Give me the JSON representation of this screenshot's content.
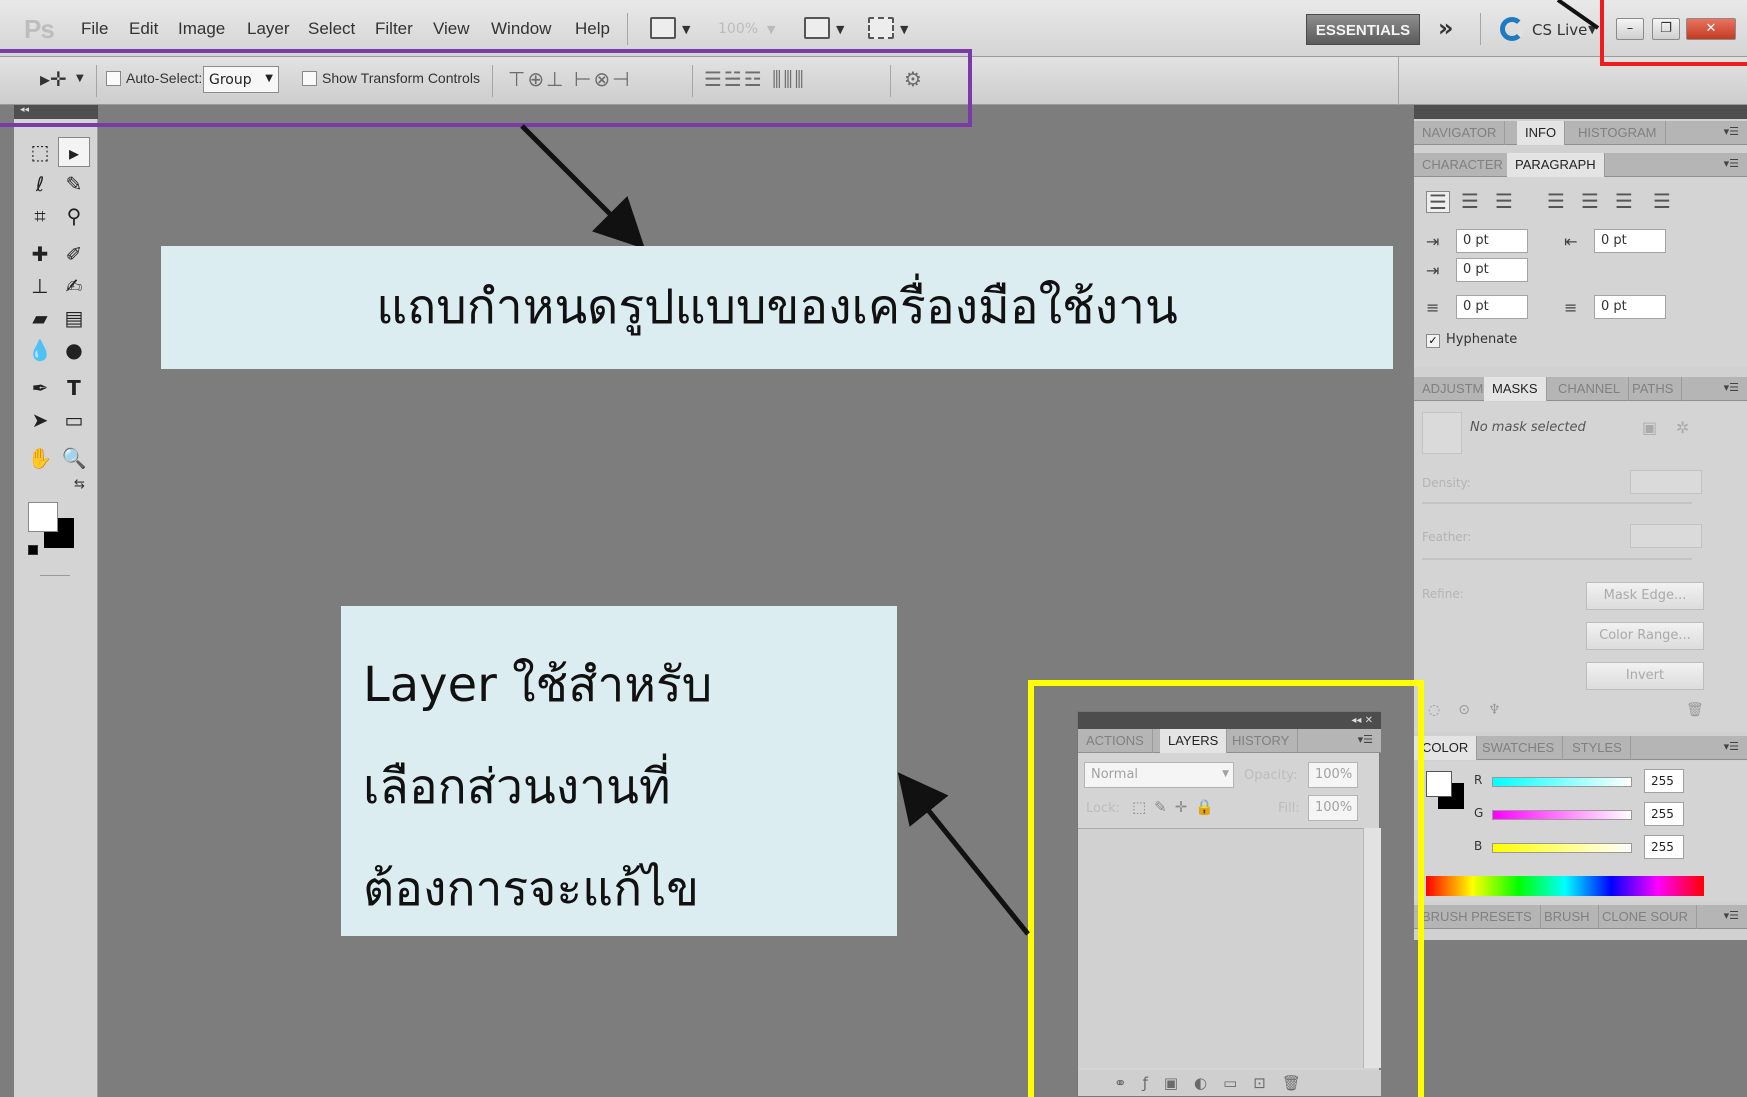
{
  "menubar": {
    "logo": "Ps",
    "items": [
      "File",
      "Edit",
      "Image",
      "Layer",
      "Select",
      "Filter",
      "View",
      "Window",
      "Help"
    ],
    "zoom": "100%",
    "essentials": "ESSENTIALS",
    "cslive": "CS Live"
  },
  "optionsbar": {
    "auto_select_label": "Auto-Select:",
    "auto_select_value": "Group",
    "show_transform_label": "Show Transform Controls"
  },
  "panels": {
    "group1_tabs": [
      "NAVIGATOR",
      "INFO",
      "HISTOGRAM"
    ],
    "group2_tabs": [
      "CHARACTER",
      "PARAGRAPH"
    ],
    "para_values": [
      "0 pt",
      "0 pt",
      "0 pt",
      "0 pt",
      "0 pt"
    ],
    "hyphenate": "Hyphenate",
    "group3_tabs": [
      "ADJUSTM",
      "MASKS",
      "CHANNEL",
      "PATHS"
    ],
    "no_mask": "No mask selected",
    "density": "Density:",
    "feather": "Feather:",
    "refine": "Refine:",
    "mask_edge": "Mask Edge...",
    "color_range": "Color Range...",
    "invert": "Invert",
    "group4_tabs": [
      "COLOR",
      "SWATCHES",
      "STYLES"
    ],
    "rgb_labels": [
      "R",
      "G",
      "B"
    ],
    "rgb_values": [
      "255",
      "255",
      "255"
    ],
    "group5_tabs": [
      "BRUSH PRESETS",
      "BRUSH",
      "CLONE SOUR"
    ]
  },
  "layers_panel": {
    "tabs": [
      "ACTIONS",
      "LAYERS",
      "HISTORY"
    ],
    "blend_mode": "Normal",
    "opacity_label": "Opacity:",
    "opacity_value": "100%",
    "lock_label": "Lock:",
    "fill_label": "Fill:",
    "fill_value": "100%"
  },
  "annotations": {
    "options_note": "แถบกำหนดรูปแบบของเครื่องมือใช้งาน",
    "layer_note": "Layer ใช้สำหรับ\nเลือกส่วนงานที่\nต้องการจะแก้ไข"
  },
  "colors": {
    "highlight_purple": "#7a3aa8",
    "highlight_red": "#ee1c1c",
    "highlight_yellow": "#ffff00",
    "note_bg": "#dcedf2",
    "canvas_gray": "#7d7d7d"
  }
}
